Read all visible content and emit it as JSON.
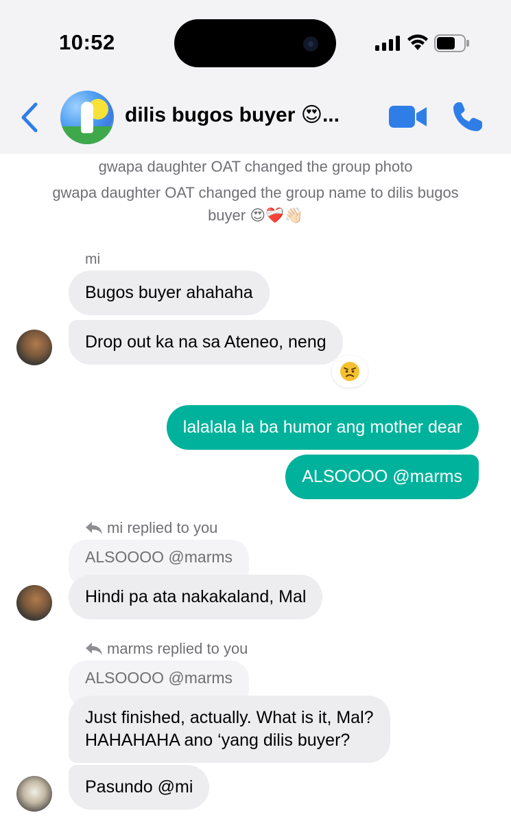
{
  "status_bar": {
    "time": "10:52"
  },
  "header": {
    "title": "dilis bugos buyer 😍...",
    "back_icon": "chevron-left-icon",
    "video_icon": "video-camera-icon",
    "call_icon": "phone-icon",
    "accent_color": "#2f7ee8"
  },
  "system_messages": [
    "gwapa daughter OAT changed the group photo",
    "gwapa daughter OAT changed the group name to dilis bugos",
    "buyer 😍❤️‍🩹👋🏻"
  ],
  "messages": [
    {
      "sender": "mi",
      "text": "Bugos buyer ahahaha"
    },
    {
      "text": "Drop out ka na sa Ateneo, neng",
      "reaction": "😠"
    },
    {
      "outgoing": true,
      "text": "lalalala la ba humor ang mother dear"
    },
    {
      "outgoing": true,
      "text": "ALSOOOO @marms"
    },
    {
      "reply_label": "mi replied to you",
      "quoted": "ALSOOOO @marms",
      "text": "Hindi pa ata nakakaland, Mal"
    },
    {
      "reply_label": "marms replied to you",
      "quoted": "ALSOOOO @marms",
      "text_line1": "Just finished, actually. What is it, Mal?",
      "text_line2": "HAHAHAHA ano ‘yang dilis buyer?"
    },
    {
      "text": "Pasundo @mi"
    }
  ],
  "colors": {
    "outgoing_bubble": "#00b29b",
    "incoming_bubble": "#ededf0",
    "system_text": "#707075"
  }
}
